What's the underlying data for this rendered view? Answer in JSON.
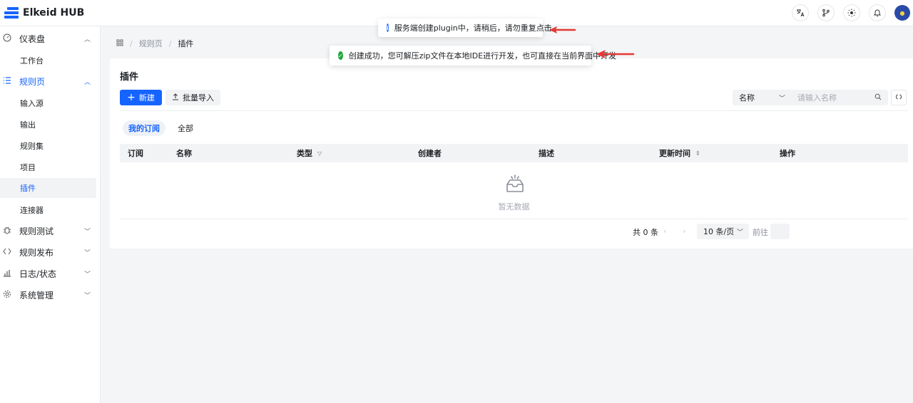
{
  "app": {
    "title": "Elkeid HUB"
  },
  "topbar": {
    "icons": [
      "translate-icon",
      "branch-icon",
      "theme-icon",
      "bell-icon",
      "avatar"
    ]
  },
  "sidebar": {
    "groups": [
      {
        "label": "仪表盘",
        "icon": "dashboard-icon",
        "expanded": true,
        "items": [
          "工作台"
        ]
      },
      {
        "label": "规则页",
        "icon": "list-icon",
        "expanded": true,
        "items": [
          "输入源",
          "输出",
          "规则集",
          "项目",
          "插件",
          "连接器"
        ]
      },
      {
        "label": "规则测试",
        "icon": "bug-icon",
        "expanded": false
      },
      {
        "label": "规则发布",
        "icon": "code-icon",
        "expanded": false
      },
      {
        "label": "日志/状态",
        "icon": "chart-icon",
        "expanded": false
      },
      {
        "label": "系统管理",
        "icon": "settings-icon",
        "expanded": false
      }
    ],
    "selected": "插件"
  },
  "breadcrumb": {
    "home_icon": "grid-icon",
    "parent": "规则页",
    "current": "插件"
  },
  "page": {
    "title": "插件",
    "new_button": "新建",
    "import_button": "批量导入",
    "filter_select": "名称",
    "search_placeholder": "请输入名称",
    "tabs": {
      "mine": "我的订阅",
      "all": "全部"
    },
    "columns": [
      "订阅",
      "名称",
      "类型",
      "创建者",
      "描述",
      "更新时间",
      "操作"
    ],
    "empty_text": "暂无数据",
    "pager": {
      "total": "共 0 条",
      "page_size": "10 条/页",
      "goto": "前往"
    }
  },
  "toasts": {
    "info": "服务端创建plugin中，请稍后，请勿重复点击",
    "success": "创建成功，您可解压zip文件在本地IDE进行开发，也可直接在当前界面中开发"
  },
  "colors": {
    "primary": "#1664ff",
    "success": "#1fa73b",
    "annotation": "#e53935"
  }
}
